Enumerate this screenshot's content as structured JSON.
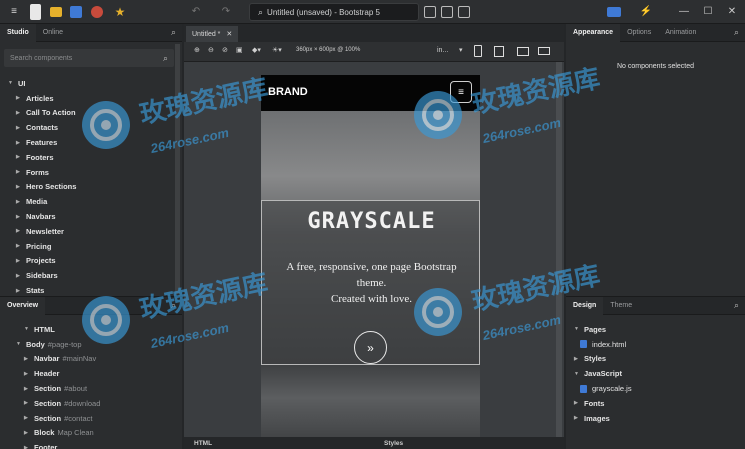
{
  "window": {
    "title": "Untitled (unsaved) - Bootstrap 5"
  },
  "left_panel": {
    "tabs": [
      "Studio",
      "Online"
    ],
    "search_placeholder": "Search components",
    "root": "UI",
    "items": [
      "Articles",
      "Call To Action",
      "Contacts",
      "Features",
      "Footers",
      "Forms",
      "Hero Sections",
      "Media",
      "Navbars",
      "Newsletter",
      "Pricing",
      "Projects",
      "Sidebars",
      "Stats"
    ]
  },
  "overview": {
    "title": "Overview",
    "items": [
      {
        "label": "HTML",
        "sub": ""
      },
      {
        "label": "Body",
        "sub": "#page-top"
      },
      {
        "label": "Navbar",
        "sub": "#mainNav"
      },
      {
        "label": "Header",
        "sub": ""
      },
      {
        "label": "Section",
        "sub": "#about"
      },
      {
        "label": "Section",
        "sub": "#download"
      },
      {
        "label": "Section",
        "sub": "#contact"
      },
      {
        "label": "Block",
        "sub": "Map Clean"
      },
      {
        "label": "Footer",
        "sub": ""
      }
    ]
  },
  "editor": {
    "tab_label": "Untitled *",
    "viewport_label": "360px × 600px @ 100%",
    "breakpoint": "in...",
    "bottom_tabs": [
      "HTML",
      "Styles"
    ]
  },
  "preview": {
    "brand": "BRAND",
    "hero_title": "GRAYSCALE",
    "hero_text_line1": "A free, responsive, one page Bootstrap",
    "hero_text_line2": "theme.",
    "hero_text_line3": "Created with love."
  },
  "right_panel": {
    "tabs": [
      "Appearance",
      "Options",
      "Animation"
    ],
    "empty_message": "No components selected"
  },
  "design_panel": {
    "tabs": [
      "Design",
      "Theme"
    ],
    "items": [
      {
        "label": "Pages",
        "type": "folder"
      },
      {
        "label": "index.html",
        "type": "file"
      },
      {
        "label": "Styles",
        "type": "folder"
      },
      {
        "label": "JavaScript",
        "type": "folder"
      },
      {
        "label": "grayscale.js",
        "type": "file"
      },
      {
        "label": "Fonts",
        "type": "folder"
      },
      {
        "label": "Images",
        "type": "folder"
      }
    ]
  },
  "watermark": {
    "cn": "玫瑰资源库",
    "url": "264rose.com"
  },
  "colors": {
    "accent": "#3f7ad6",
    "red": "#c84b3c",
    "yellow": "#e6b12c",
    "watermark": "#3a9ad8"
  }
}
